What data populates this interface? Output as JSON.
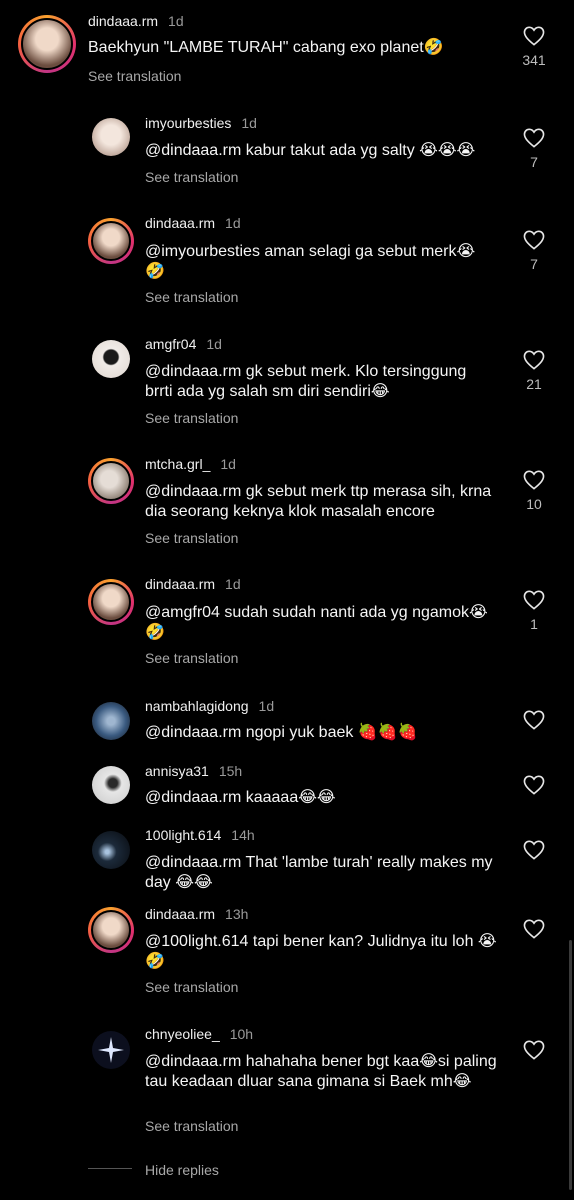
{
  "see_translation": "See translation",
  "hide_replies": "Hide replies",
  "comments": [
    {
      "user": "dindaaa.rm",
      "time": "1d",
      "text": "Baekhyun \"LAMBE TURAH\" cabang exo planet🤣",
      "likes": "341",
      "translation": true,
      "avatar_color": "#c9a48b"
    },
    {
      "user": "imyourbesties",
      "time": "1d",
      "text": "@dindaaa.rm kabur takut ada yg salty 😭😭😭",
      "likes": "7",
      "translation": true,
      "avatar_color": "#d8c9c0"
    },
    {
      "user": "dindaaa.rm",
      "time": "1d",
      "text": "@imyourbesties aman selagi ga sebut merk😭🤣",
      "likes": "7",
      "translation": true,
      "avatar_color": "#c9a48b"
    },
    {
      "user": "amgfr04",
      "time": "1d",
      "text": "@dindaaa.rm gk sebut merk. Klo tersinggung brrti ada yg salah sm diri sendiri😂",
      "likes": "21",
      "translation": true,
      "avatar_color": "#e8e0dc"
    },
    {
      "user": "mtcha.grl_",
      "time": "1d",
      "text": "@dindaaa.rm gk sebut merk ttp merasa sih, krna dia seorang keknya klok masalah encore",
      "likes": "10",
      "translation": true,
      "avatar_color": "#cfc8c2"
    },
    {
      "user": "dindaaa.rm",
      "time": "1d",
      "text": "@amgfr04 sudah sudah nanti ada yg ngamok😭🤣",
      "likes": "1",
      "translation": true,
      "avatar_color": "#c9a48b"
    },
    {
      "user": "nambahlagidong",
      "time": "1d",
      "text": "@dindaaa.rm ngopi yuk baek 🍓🍓🍓",
      "likes": "",
      "translation": false,
      "avatar_color": "#3a5a80"
    },
    {
      "user": "annisya31",
      "time": "15h",
      "text": "@dindaaa.rm kaaaaa😂😂",
      "likes": "",
      "translation": false,
      "avatar_color": "#dcdcdc"
    },
    {
      "user": "100light.614",
      "time": "14h",
      "text": "@dindaaa.rm That 'lambe turah' really makes my day 😂😂",
      "likes": "",
      "translation": false,
      "avatar_color": "#1c2a3a"
    },
    {
      "user": "dindaaa.rm",
      "time": "13h",
      "text": "@100light.614 tapi bener kan? Julidnya itu loh 😭🤣",
      "likes": "",
      "translation": true,
      "avatar_color": "#c9a48b"
    },
    {
      "user": "chnyeoliee_",
      "time": "10h",
      "text": "@dindaaa.rm hahahaha bener bgt kaa😂si paling tau keadaan dluar sana gimana si Baek mh😂",
      "likes": "",
      "translation": true,
      "avatar_color": "#0c0f1e"
    }
  ]
}
